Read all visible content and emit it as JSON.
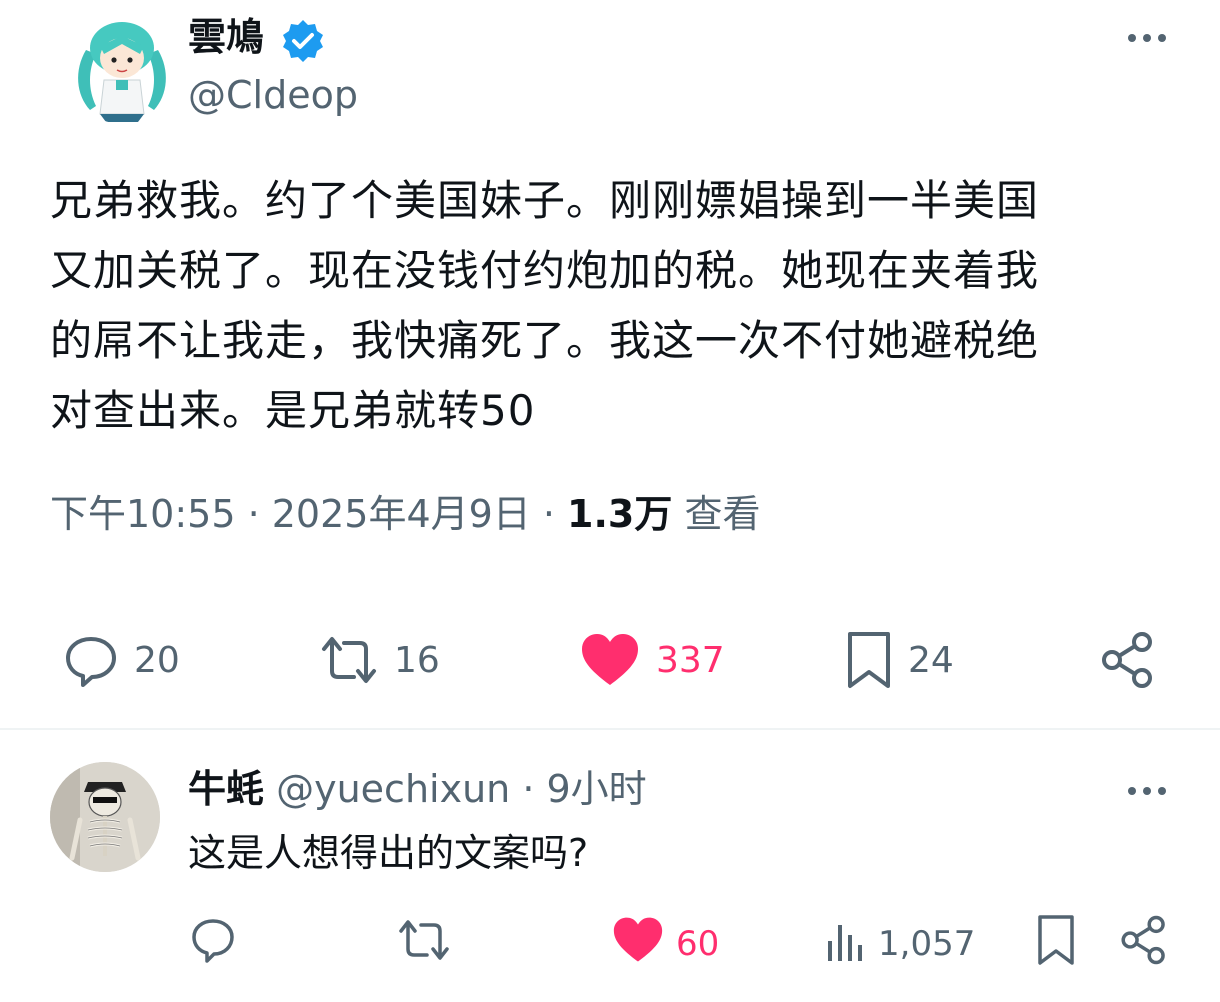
{
  "post": {
    "display_name": "雲鳩",
    "handle": "@Cldeop",
    "text_lines": [
      "兄弟救我。约了个美国妹子。刚刚嫖娼操到一半美国",
      "又加关税了。现在没钱付约炮加的税。她现在夹着我",
      "的屌不让我走，我快痛死了。我这一次不付她避税绝",
      "对查出来。是兄弟就转50"
    ],
    "meta_time": "下午10:55 · 2025年4月9日 · ",
    "meta_views": "1.3万",
    "meta_views_label": " 查看",
    "replies": "20",
    "reposts": "16",
    "likes": "337",
    "bookmarks": "24"
  },
  "reply": {
    "display_name": "牛蚝",
    "handle": "@yuechixun",
    "time": " · 9小时",
    "text": "这是人想得出的文案吗?",
    "likes": "60",
    "views": "1,057"
  },
  "icons": {
    "verified": "verified-badge-icon",
    "more": "more-horizontal-icon",
    "reply": "comment-bubble-icon",
    "repost": "repost-arrows-icon",
    "like": "heart-icon",
    "bookmark": "bookmark-icon",
    "share": "share-nodes-icon",
    "views": "bar-chart-icon"
  },
  "colors": {
    "text": "#0f1419",
    "secondary": "#536471",
    "verified": "#1d9bf0",
    "like": "#ff2e6e",
    "divider": "#eff3f4"
  }
}
